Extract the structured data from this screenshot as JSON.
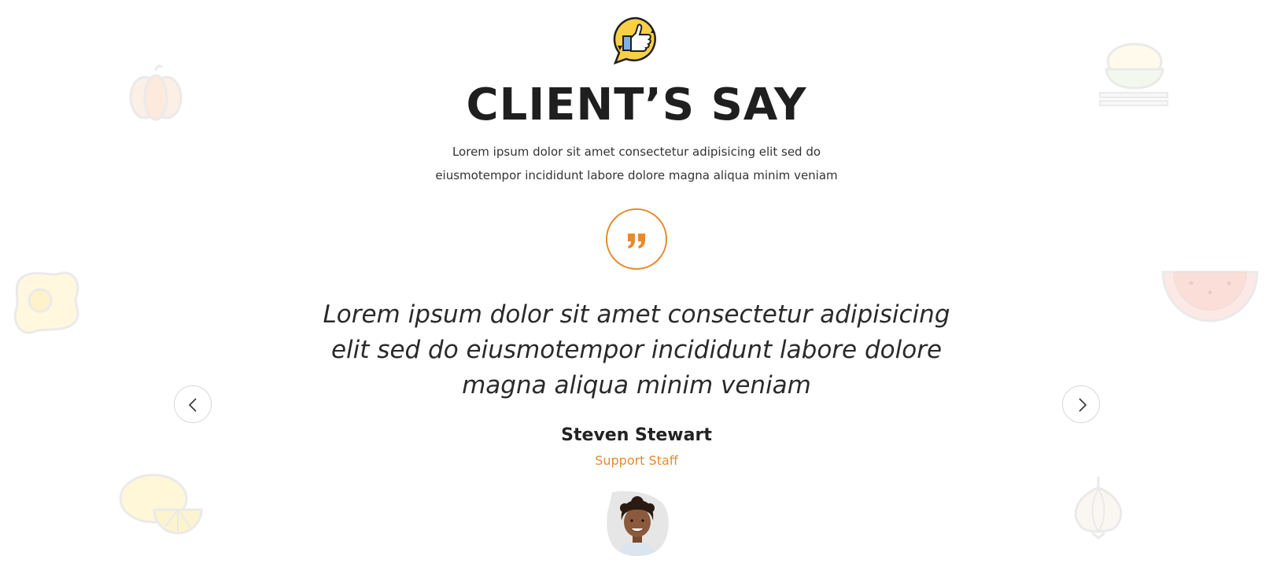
{
  "section": {
    "title": "CLIENT’S SAY",
    "subtitle_line1": "Lorem ipsum dolor sit amet consectetur adipisicing elit sed do",
    "subtitle_line2": "eiusmotempor incididunt labore dolore magna aliqua minim veniam"
  },
  "testimonial": {
    "quote_line1": "Lorem ipsum dolor sit amet consectetur adipisicing",
    "quote_line2": "elit sed do eiusmotempor incididunt labore dolore",
    "quote_line3": "magna aliqua minim veniam",
    "author_name": "Steven Stewart",
    "author_role": "Support Staff"
  },
  "icons": {
    "badge": "thumbs-up-speech-bubble-icon",
    "quote": "quote-icon",
    "prev": "chevron-left-icon",
    "next": "chevron-right-icon",
    "decorations": [
      "pumpkin-icon",
      "fried-egg-icon",
      "lemon-icon",
      "rice-bowl-icon",
      "watermelon-icon",
      "onion-icon"
    ]
  },
  "colors": {
    "accent": "#e68a2e",
    "title": "#1f1f1f",
    "text": "#333333",
    "badge_yellow": "#f7d046"
  }
}
